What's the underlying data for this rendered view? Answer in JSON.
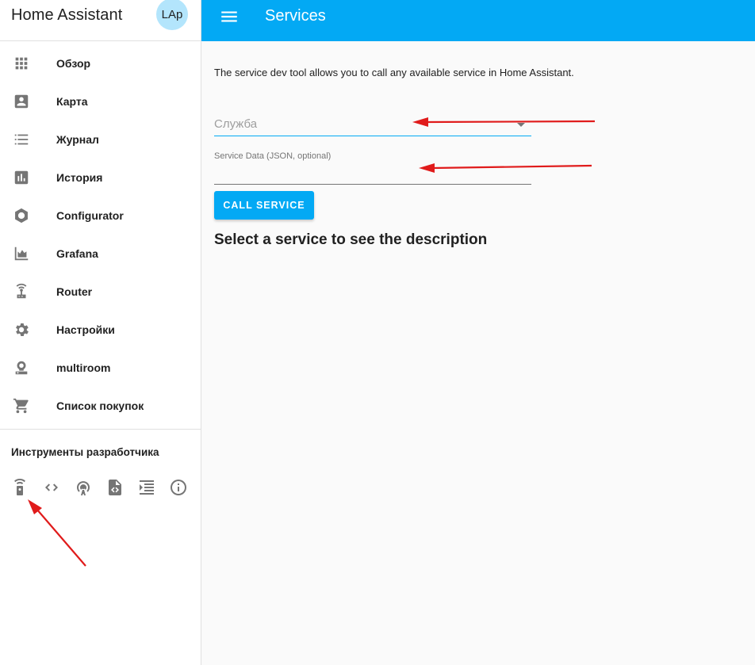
{
  "app": {
    "title": "Home Assistant",
    "avatar_initials": "LAp"
  },
  "sidebar": {
    "items": [
      {
        "label": "Обзор",
        "icon": "apps-grid-icon"
      },
      {
        "label": "Карта",
        "icon": "account-box-icon"
      },
      {
        "label": "Журнал",
        "icon": "list-icon"
      },
      {
        "label": "История",
        "icon": "chart-box-icon"
      },
      {
        "label": "Configurator",
        "icon": "hexagon-icon"
      },
      {
        "label": "Grafana",
        "icon": "area-chart-icon"
      },
      {
        "label": "Router",
        "icon": "router-wireless-icon"
      },
      {
        "label": "Настройки",
        "icon": "gear-icon"
      },
      {
        "label": "multiroom",
        "icon": "speaker-icon"
      },
      {
        "label": "Список покупок",
        "icon": "cart-icon"
      }
    ],
    "dev_tools_title": "Инструменты разработчика",
    "dev_tools": [
      {
        "icon": "remote-icon"
      },
      {
        "icon": "code-tags-icon"
      },
      {
        "icon": "radio-tower-icon"
      },
      {
        "icon": "file-code-icon"
      },
      {
        "icon": "format-indent-icon"
      },
      {
        "icon": "info-circle-icon"
      }
    ]
  },
  "toolbar": {
    "title": "Services"
  },
  "main": {
    "description": "The service dev tool allows you to call any available service in Home Assistant.",
    "service_placeholder": "Служба",
    "service_data_label": "Service Data (JSON, optional)",
    "call_button": "CALL SERVICE",
    "select_prompt": "Select a service to see the description"
  },
  "colors": {
    "accent": "#03a9f4",
    "annotation_arrow": "#e01b1b"
  }
}
